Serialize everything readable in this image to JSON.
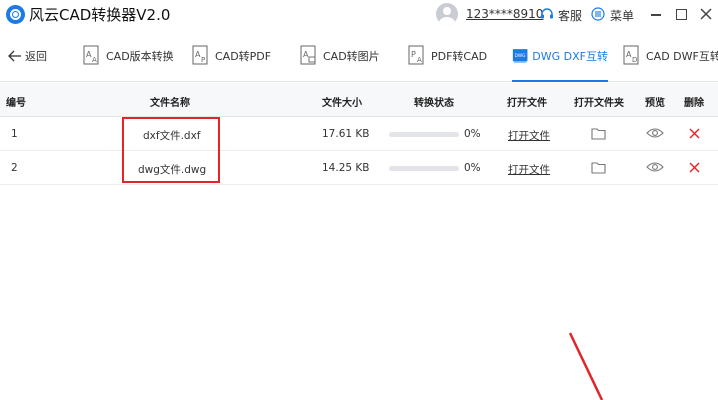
{
  "app": {
    "title": "风云CAD转换器V2.0",
    "user_phone": "123****8910",
    "service_label": "客服",
    "menu_label": "菜单"
  },
  "toolbar": {
    "back_label": "返回",
    "tabs": [
      {
        "label": "CAD版本转换",
        "icon": "cad-version-icon",
        "active": false
      },
      {
        "label": "CAD转PDF",
        "icon": "cad-to-pdf-icon",
        "active": false
      },
      {
        "label": "CAD转图片",
        "icon": "cad-to-image-icon",
        "active": false
      },
      {
        "label": "PDF转CAD",
        "icon": "pdf-to-cad-icon",
        "active": false
      },
      {
        "label": "DWG DXF互转",
        "icon": "dwg-dxf-icon",
        "active": true
      },
      {
        "label": "CAD DWF互转",
        "icon": "cad-dwf-icon",
        "active": false
      }
    ]
  },
  "table": {
    "headers": {
      "index": "编号",
      "name": "文件名称",
      "size": "文件大小",
      "status": "转换状态",
      "open_file": "打开文件",
      "open_folder": "打开文件夹",
      "preview": "预览",
      "delete": "删除"
    },
    "rows": [
      {
        "index": "1",
        "name": "dxf文件.dxf",
        "size": "17.61 KB",
        "progress": 0,
        "progress_text": "0%",
        "open_label": "打开文件"
      },
      {
        "index": "2",
        "name": "dwg文件.dwg",
        "size": "14.25 KB",
        "progress": 0,
        "progress_text": "0%",
        "open_label": "打开文件"
      }
    ]
  },
  "colors": {
    "accent": "#1a7be6",
    "highlight": "#e0262b",
    "delete": "#e0262b"
  }
}
